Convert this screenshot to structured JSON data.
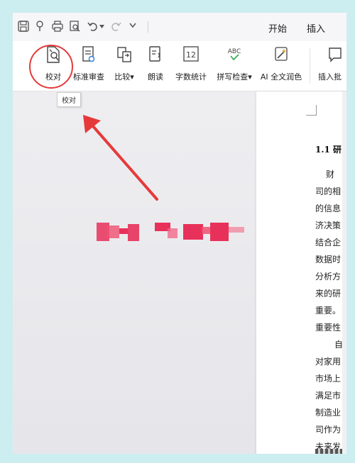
{
  "menu": {
    "start": "开始",
    "insert": "插入"
  },
  "ribbon": {
    "tools": [
      {
        "name": "proofread",
        "label": "校对"
      },
      {
        "name": "standard-review",
        "label": "标准审查"
      },
      {
        "name": "compare",
        "label": "比较"
      },
      {
        "name": "read-aloud",
        "label": "朗读"
      },
      {
        "name": "word-count",
        "label": "字数统计"
      },
      {
        "name": "spell-check",
        "label": "拼写检查"
      },
      {
        "name": "ai-polish",
        "label": "AI 全文润色"
      },
      {
        "name": "insert-comment",
        "label": "插入批"
      }
    ],
    "dropdown_mark": "▾",
    "word_count_icon_text": "12",
    "spell_icon_text": "ABC"
  },
  "tooltip": {
    "text": "校对"
  },
  "document": {
    "heading": "1.1 研",
    "lines": [
      "财",
      "司的相",
      "的信息",
      "济决策",
      "结合企",
      "数据时",
      "分析方",
      "来的研",
      "重要。",
      "重要性",
      "自",
      "对家用",
      "市场上",
      "满足市",
      "制造业",
      "司作为",
      "未来发"
    ]
  },
  "colors": {
    "annotation": "#e63a3a",
    "redaction": "#e8315a"
  }
}
